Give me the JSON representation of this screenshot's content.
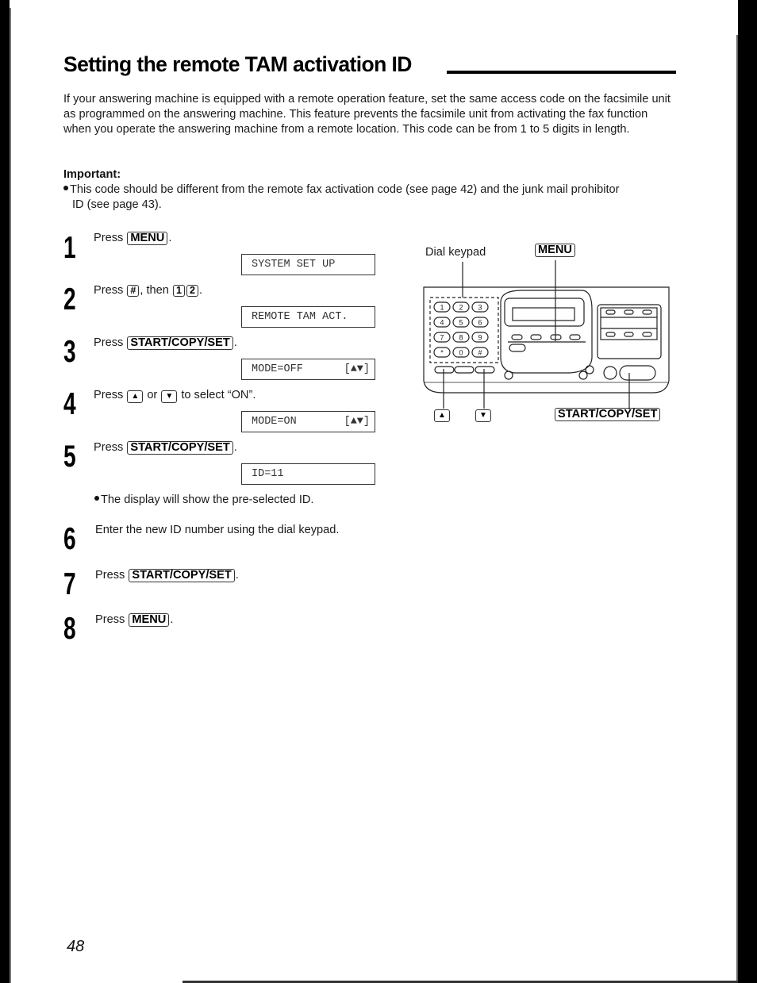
{
  "page": {
    "title": "Setting the remote TAM activation ID",
    "intro": "If your answering machine is equipped with a remote operation feature, set the same access code on the facsimile unit as programmed on the answering machine. This feature prevents the facsimile unit from activating the fax function when you operate the answering machine from a remote location. This code can be from 1 to 5 digits in length.",
    "important": {
      "heading": "Important:",
      "line1": "This code should be different from the remote fax activation code (see page 42) and the junk mail prohibitor",
      "line2": "ID (see page 43)."
    },
    "page_number": "48"
  },
  "steps": [
    {
      "num": "1",
      "pre": "Press ",
      "key1": "MENU",
      "post": "."
    },
    {
      "num": "2",
      "pre": "Press ",
      "key1": "#",
      "mid": ", then ",
      "key2": "1",
      "key3": "2",
      "post": "."
    },
    {
      "num": "3",
      "pre": "Press ",
      "key1": "START/COPY/SET",
      "post": "."
    },
    {
      "num": "4",
      "pre": "Press ",
      "key1": "▲",
      "mid": " or ",
      "key2": "▼",
      "post": " to select “ON”."
    },
    {
      "num": "5",
      "pre": "Press ",
      "key1": "START/COPY/SET",
      "post": "."
    },
    {
      "num": "6",
      "text": "Enter the new ID number using the dial keypad."
    },
    {
      "num": "7",
      "pre": "Press ",
      "key1": "START/COPY/SET",
      "post": "."
    },
    {
      "num": "8",
      "pre": "Press ",
      "key1": "MENU",
      "post": "."
    }
  ],
  "displays": [
    {
      "text": "SYSTEM SET UP",
      "arrows": ""
    },
    {
      "text": "REMOTE TAM ACT.",
      "arrows": ""
    },
    {
      "text": "MODE=OFF",
      "arrows": "[▲▼]"
    },
    {
      "text": "MODE=ON",
      "arrows": "[▲▼]"
    },
    {
      "text": "ID=11",
      "arrows": ""
    }
  ],
  "note": "The display will show the pre-selected ID.",
  "diagram": {
    "label_keypad": "Dial keypad",
    "label_menu": "MENU",
    "label_up": "▲",
    "label_down": "▼",
    "label_start": "START/COPY/SET",
    "keypad_keys": [
      "1",
      "2",
      "3",
      "4",
      "5",
      "6",
      "7",
      "8",
      "9",
      "*",
      "0",
      "#"
    ]
  }
}
